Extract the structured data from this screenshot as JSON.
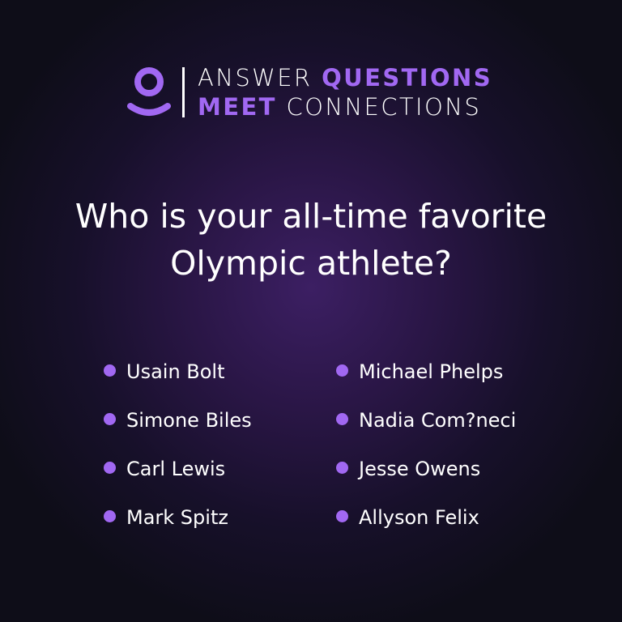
{
  "colors": {
    "accent": "#a168f2",
    "text": "#ffffff",
    "background": "#120f1f"
  },
  "header": {
    "logo_icon": "person-icon",
    "line1": {
      "word1": "ANSWER",
      "word2": "QUESTIONS"
    },
    "line2": {
      "word1": "MEET",
      "word2": "CONNECTIONS"
    }
  },
  "question": {
    "line1": "Who is your all-time favorite",
    "line2": "Olympic athlete?"
  },
  "options": [
    "Usain Bolt",
    "Michael Phelps",
    "Simone Biles",
    "Nadia Com?neci",
    "Carl Lewis",
    "Jesse Owens",
    "Mark Spitz",
    "Allyson Felix"
  ]
}
